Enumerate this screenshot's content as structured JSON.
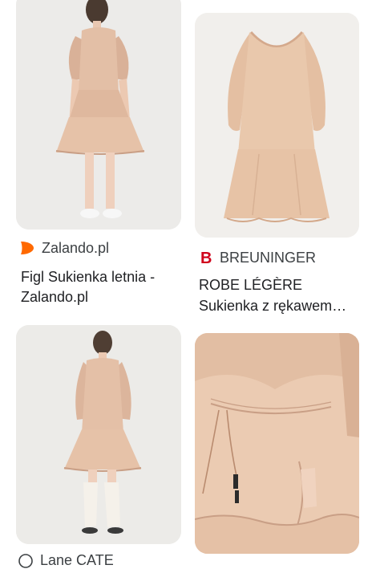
{
  "results": [
    {
      "source": "Zalando.pl",
      "source_icon": "zalando-icon",
      "title_line1": "Figl Sukienka letnia -",
      "title_line2": "Zalando.pl",
      "accent": "#ff6900"
    },
    {
      "source": "BREUNINGER",
      "source_icon": "breuninger-icon",
      "title_line1": "ROBE LÉGÈRE",
      "title_line2": "Sukienka z rękawem…",
      "accent": "#d0021b"
    },
    {
      "source": "Lane CATE",
      "source_icon": "globe-icon"
    },
    {
      "source": ""
    }
  ],
  "colors": {
    "dress": "#e7c4a9",
    "dress_shadow": "#d4a98c",
    "background_grey": "#ecebe8",
    "background_wall": "#f2efea"
  }
}
